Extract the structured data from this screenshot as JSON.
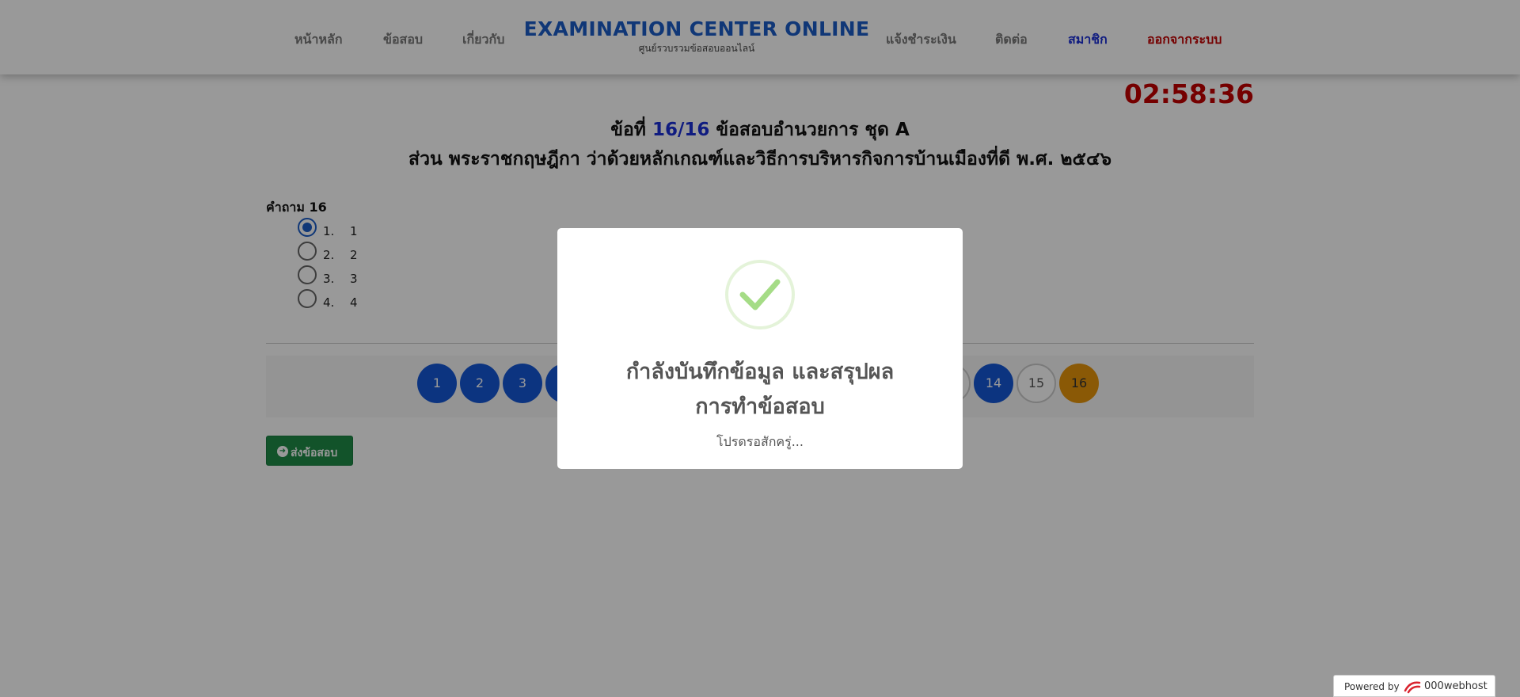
{
  "nav": {
    "left": [
      "หน้าหลัก",
      "ข้อสอบ",
      "เกี่ยวกับ"
    ],
    "right": [
      "แจ้งชำระเงิน",
      "ติดต่อ",
      "สมาชิก",
      "ออกจากระบบ"
    ],
    "brand_title": "EXAMINATION CENTER ONLINE",
    "brand_subtitle": "ศูนย์รวบรวมข้อสอบออนไลน์",
    "colors": {
      "member": "#1b2fd6",
      "logout": "#c40000"
    }
  },
  "timer": "02:58:36",
  "heading": {
    "prefix": "ข้อที่",
    "number": "16/16",
    "suffix": "ข้อสอบอำนวยการ ชุด A",
    "section": "ส่วน พระราชกฤษฎีกา ว่าด้วยหลักเกณฑ์และวิธีการบริหารกิจการบ้านเมืองที่ดี พ.ศ. ๒๕๔๖"
  },
  "question": {
    "label": "คำถาม 16",
    "choices": [
      {
        "num": "1.",
        "text": "1",
        "selected": true
      },
      {
        "num": "2.",
        "text": "2",
        "selected": false
      },
      {
        "num": "3.",
        "text": "3",
        "selected": false
      },
      {
        "num": "4.",
        "text": "4",
        "selected": false
      }
    ]
  },
  "pagination": {
    "visible_left": [
      "1",
      "2",
      "3"
    ],
    "visible_right": [
      {
        "label": "14",
        "state": "answered"
      },
      {
        "label": "15",
        "state": "empty"
      },
      {
        "label": "16",
        "state": "current"
      }
    ]
  },
  "submit": {
    "label": "ส่งข้อสอบ",
    "icon": "arrow-circle-right-icon"
  },
  "modal": {
    "icon": "success-check-icon",
    "title_line1": "กำลังบันทึกข้อมูล และสรุปผล",
    "title_line2": "การทำข้อสอบ",
    "text": "โปรดรอสักครู่..."
  },
  "powered_by": {
    "label": "Powered by",
    "brand": "000webhost"
  }
}
